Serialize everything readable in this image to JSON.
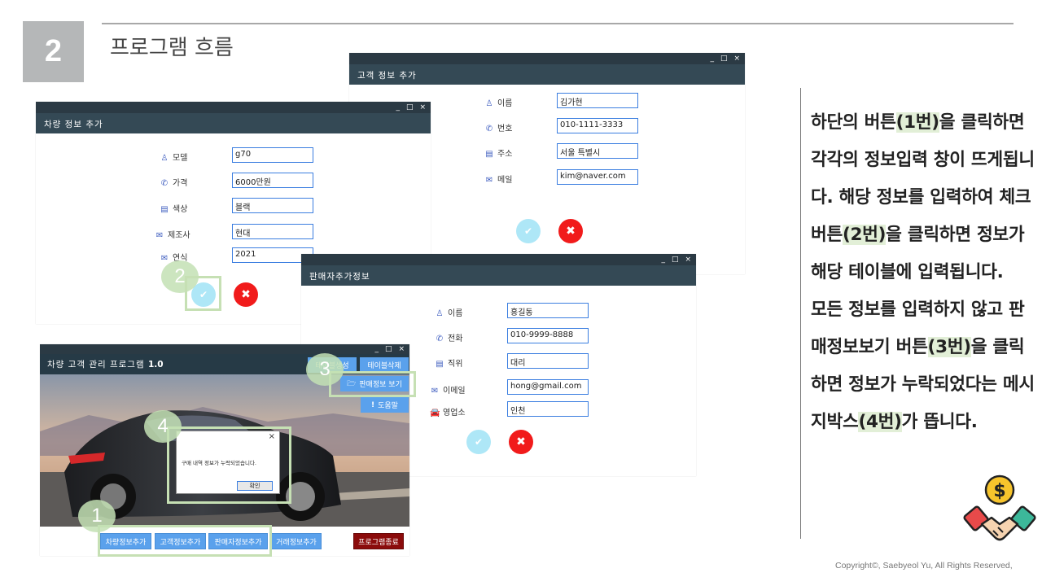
{
  "slide": {
    "number": "2",
    "title": "프로그램 흐름",
    "copyright": "Copyright©, Saebyeol Yu, All Rights Reserved,"
  },
  "explanation": {
    "p1": "하단의 버튼",
    "h1": "(1번)",
    "p2": "을 클릭하면 각각의 정보입력 창이 뜨게됩니다. 해당 정보를 입력하여 체크버튼",
    "h2": "(2번)",
    "p3": "을 클릭하면 정보가 해당 테이블에 입력됩니다.",
    "p4": "모든 정보를 입력하지 않고 판매정보보기 버튼",
    "h3": "(3번)",
    "p5": "을 클릭하면 정보가 누락되었다는 메시지박스",
    "h4": "(4번)",
    "p6": "가 뜹니다."
  },
  "window_controls": {
    "min": "_",
    "max": "□",
    "close": "×"
  },
  "car_form": {
    "title": "차량 정보 추가",
    "fields": [
      {
        "icon": "person-icon",
        "label": "모델",
        "value": "g70"
      },
      {
        "icon": "phone-icon",
        "label": "가격",
        "value": "6000만원"
      },
      {
        "icon": "id-card-icon",
        "label": "색상",
        "value": "블랙"
      },
      {
        "icon": "envelope-icon",
        "label": "제조사",
        "value": "현대"
      },
      {
        "icon": "envelope-icon",
        "label": "연식",
        "value": "2021"
      }
    ]
  },
  "customer_form": {
    "title": "고객 정보 추가",
    "fields": [
      {
        "icon": "person-icon",
        "label": "이름",
        "value": "김가현"
      },
      {
        "icon": "phone-icon",
        "label": "번호",
        "value": "010-1111-3333"
      },
      {
        "icon": "id-card-icon",
        "label": "주소",
        "value": "서울 특별시"
      },
      {
        "icon": "envelope-icon",
        "label": "메일",
        "value": "kim@naver.com"
      }
    ]
  },
  "seller_form": {
    "title": "판매자추가정보",
    "fields": [
      {
        "icon": "person-icon",
        "label": "이름",
        "value": "홍길동"
      },
      {
        "icon": "phone-icon",
        "label": "전화",
        "value": "010-9999-8888"
      },
      {
        "icon": "id-card-icon",
        "label": "직위",
        "value": "대리"
      },
      {
        "icon": "envelope-icon",
        "label": "이메일",
        "value": "hong@gmail.com"
      },
      {
        "icon": "car-icon",
        "label": "영업소",
        "value": "인천"
      }
    ]
  },
  "main_window": {
    "title": "차량 고객 관리 프로그램",
    "version": "1.0",
    "top_buttons": {
      "create_table": "테이블생성",
      "delete_table": "테이블삭제",
      "view_sales": "판매정보 보기",
      "help": "도움말"
    },
    "bottom_buttons": {
      "add_car": "차량정보추가",
      "add_customer": "고객정보추가",
      "add_seller": "판매자정보추가",
      "add_trade": "거래정보추가",
      "exit": "프로그램종료"
    },
    "message_box": {
      "text": "구매 내역 정보가 누락되었습니다.",
      "confirm": "확인",
      "close": "×"
    }
  },
  "markers": {
    "m1": "1",
    "m2": "2",
    "m3": "3",
    "m4": "4"
  },
  "colors": {
    "titlebar": "#2b3a44",
    "header": "#344955",
    "accent_blue": "#5aa1ec",
    "confirm": "#aee7f7",
    "cancel": "#f11b1b",
    "highlight_green": "#c6e0b4",
    "exit_button": "#8b0b0b"
  }
}
